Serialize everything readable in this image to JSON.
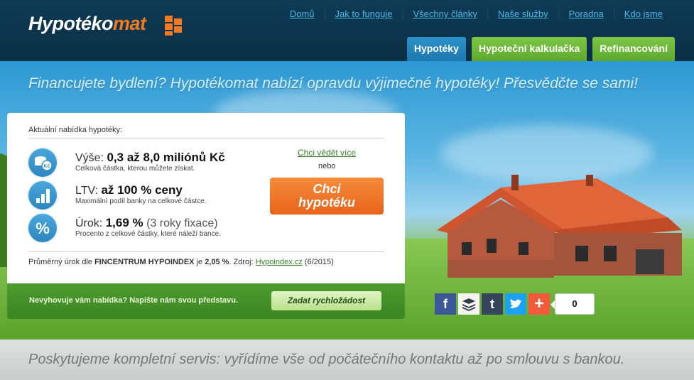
{
  "brand": {
    "logo_main": "Hypotéko",
    "logo_accent": "mat"
  },
  "topnav": [
    "Domů",
    "Jak to funguje",
    "Všechny články",
    "Naše služby",
    "Poradna",
    "Kdo jsme"
  ],
  "tabs": [
    "Hypotéky",
    "Hypoteční kalkulačka",
    "Refinancování"
  ],
  "slogan": "Financujete bydlení? Hypotékomat nabízí opravdu výjimečné hypotéky! Přesvědčte se sami!",
  "offer": {
    "title": "Aktuální nabídka hypotéky:",
    "rows": [
      {
        "label": "Výše:",
        "value": "0,3 až 8,0 miliónů Kč",
        "suffix": "",
        "sub": "Celková částka, kterou můžete získat."
      },
      {
        "label": "LTV:",
        "value": "až 100 % ceny",
        "suffix": "",
        "sub": "Maximální podíl banky na celkové částce."
      },
      {
        "label": "Úrok:",
        "value": "1,69 %",
        "suffix": "(3 roky fixace)",
        "sub": "Procento z celkové částky, které náleží bance."
      }
    ],
    "more_link": "Chci vědět více",
    "or": "nebo",
    "cta_line1": "Chci",
    "cta_line2": "hypotéku",
    "avg_prefix": "Průměrný úrok dle",
    "avg_index": "FINCENTRUM HYPOINDEX",
    "avg_mid": "je",
    "avg_value": "2,05 %",
    "avg_source_label": ". Zdroj:",
    "avg_source_link": "Hypoindex.cz",
    "avg_period": "(6/2015)"
  },
  "request": {
    "question": "Nevyhovuje vám nabídka? Napište nám svou představu.",
    "button": "Zadat rychložádost"
  },
  "social": {
    "count": "0",
    "icons": [
      "facebook-icon",
      "buffer-icon",
      "tumblr-icon",
      "twitter-icon",
      "plus-icon"
    ],
    "colors": [
      "#3b5998",
      "#323b43",
      "#35465c",
      "#1da1f2",
      "#f05a3a"
    ]
  },
  "band": "Poskytujeme kompletní servis: vyřídíme vše od počátečního kontaktu až po smlouvu s bankou."
}
